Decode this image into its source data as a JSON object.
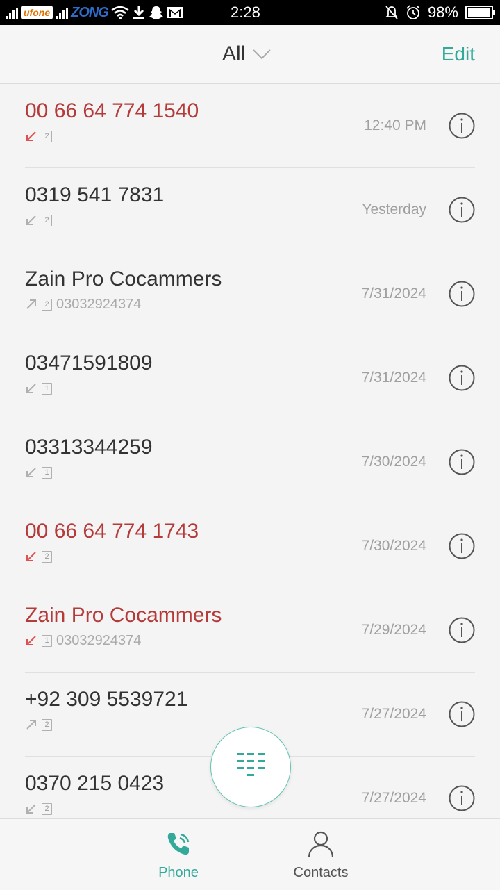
{
  "status_bar": {
    "carrier1": "ufone",
    "carrier2": "ZONG",
    "time": "2:28",
    "battery": "98%",
    "battery_level": 0.98
  },
  "header": {
    "filter_label": "All",
    "edit_label": "Edit"
  },
  "calls": [
    {
      "name": "00 66 64 774 1540",
      "missed": true,
      "direction": "incoming",
      "sim": "2",
      "number": "",
      "time": "12:40 PM"
    },
    {
      "name": "0319 541 7831",
      "missed": false,
      "direction": "incoming",
      "sim": "2",
      "number": "",
      "time": "Yesterday"
    },
    {
      "name": "Zain Pro Cocammers",
      "missed": false,
      "direction": "outgoing",
      "sim": "2",
      "number": "03032924374",
      "time": "7/31/2024"
    },
    {
      "name": "03471591809",
      "missed": false,
      "direction": "incoming",
      "sim": "1",
      "number": "",
      "time": "7/31/2024"
    },
    {
      "name": "03313344259",
      "missed": false,
      "direction": "incoming",
      "sim": "1",
      "number": "",
      "time": "7/30/2024"
    },
    {
      "name": "00 66 64 774 1743",
      "missed": true,
      "direction": "incoming",
      "sim": "2",
      "number": "",
      "time": "7/30/2024"
    },
    {
      "name": "Zain Pro Cocammers",
      "missed": true,
      "direction": "incoming",
      "sim": "1",
      "number": "03032924374",
      "time": "7/29/2024"
    },
    {
      "name": "+92 309 5539721",
      "missed": false,
      "direction": "outgoing",
      "sim": "2",
      "number": "",
      "time": "7/27/2024"
    },
    {
      "name": "0370 215 0423",
      "missed": false,
      "direction": "incoming",
      "sim": "2",
      "number": "",
      "time": "7/27/2024"
    }
  ],
  "colors": {
    "accent": "#33a99a",
    "missed": "#b53a3a",
    "missed_arrow": "#e05050",
    "normal_arrow": "#b0b0b0"
  },
  "bottom_nav": {
    "phone_label": "Phone",
    "contacts_label": "Contacts"
  }
}
